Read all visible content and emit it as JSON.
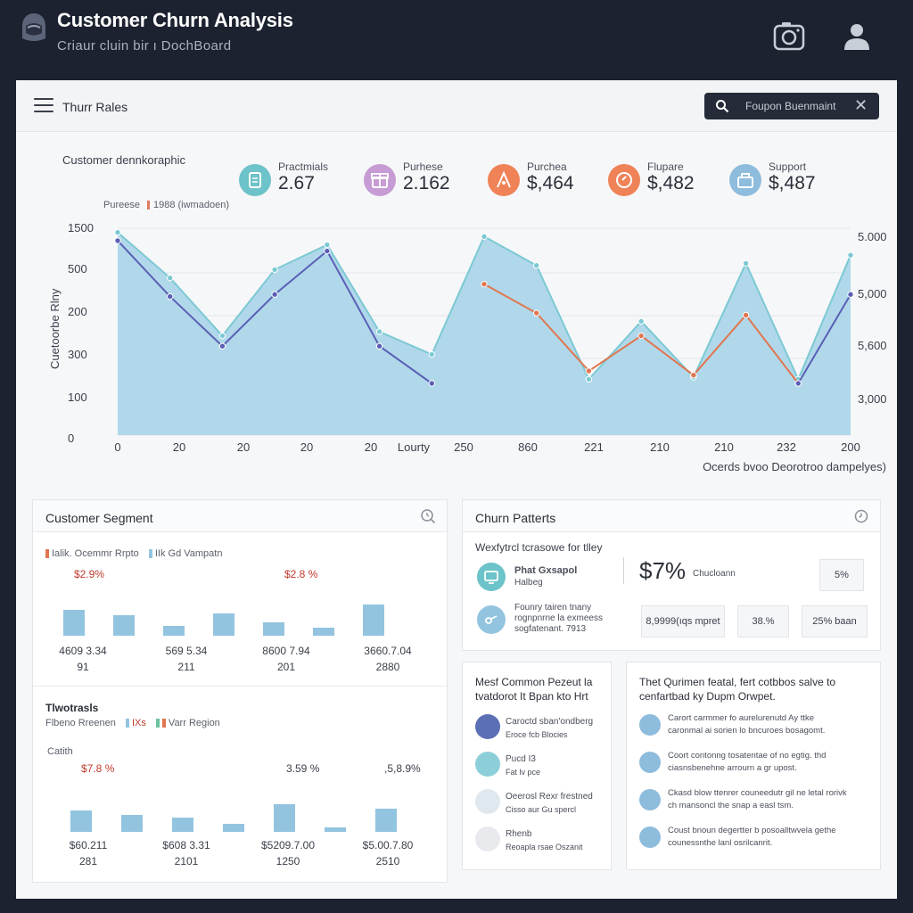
{
  "header": {
    "title": "Customer Churn Analysis",
    "subtitle": "Criaur cluin bir ı DochBoard",
    "icons": [
      "camera-icon",
      "user-icon"
    ]
  },
  "panel": {
    "title": "Thurr Rales",
    "search_text": "Foupon Buenmaint",
    "search_close": "✕"
  },
  "overview": {
    "demographics_label": "Customer dennkoraphic",
    "metrics": [
      {
        "label": "Practmials",
        "value": "2.67",
        "color": "#6cc3c9",
        "icon": "clipboard-icon"
      },
      {
        "label": "Purhese",
        "value": "2.162",
        "color": "#c79bd3",
        "icon": "gift-icon"
      },
      {
        "label": "Purchea",
        "value": "$,464",
        "color": "#ef8257",
        "icon": "person-icon"
      },
      {
        "label": "Flupare",
        "value": "$,482",
        "color": "#ef8257",
        "icon": "chat-icon"
      },
      {
        "label": "Support",
        "value": "$,487",
        "color": "#8dbcdc",
        "icon": "bag-icon"
      }
    ],
    "legend": {
      "left": "Pureese",
      "right": "1988 (iwmadoen)"
    }
  },
  "chart_data": {
    "type": "line",
    "title": "",
    "xlabel": "Lourty",
    "ylabel": "Cuetoorbe Rlny",
    "y_ticks_left": [
      "1500",
      "500",
      "200",
      "300",
      "100",
      "0"
    ],
    "y_ticks_right": [
      "5.000",
      "5,000",
      "5,600",
      "3,000"
    ],
    "x_ticks": [
      "0",
      "20",
      "20",
      "20",
      "20",
      "250",
      "860",
      "221",
      "210",
      "210",
      "232",
      "200"
    ],
    "footnote": "Ocerds bvoo Deorotroo dampelyes)",
    "series": [
      {
        "color": "#7cc9d3",
        "values": [
          98,
          76,
          48,
          80,
          92,
          50,
          39,
          96,
          82,
          27,
          55,
          28,
          83,
          27,
          87
        ]
      },
      {
        "color": "#5b5fb5",
        "values": [
          94,
          67,
          43,
          68,
          89,
          43,
          25
        ]
      },
      {
        "color": "#e0764f",
        "values": [
          73,
          59,
          31,
          48,
          29,
          58,
          25
        ]
      },
      {
        "color": "#5b5fb5",
        "values": [
          25,
          68
        ]
      }
    ],
    "area_color": "#a8d4e8"
  },
  "segment": {
    "title": "Customer Segment",
    "legend_a": "Ialik. Ocemmr Rrpto",
    "legend_b": "IIk Gd Vampatn",
    "pct_a": "$2.9%",
    "pct_b": "$2.8 %",
    "bars_top": [
      0.47,
      0.37,
      0.18,
      0.4,
      0.24,
      0.14,
      0.56
    ],
    "labels_top": [
      {
        "a": "4609 3.34",
        "b": "91"
      },
      {
        "a": "569 5.34",
        "b": "211"
      },
      {
        "a": "8600 7.94",
        "b": "201"
      },
      {
        "a": "3660.7.04",
        "b": "2880"
      }
    ],
    "sub_title": "Tlwotrasls",
    "sub_legend": "Flbeno Rreenen",
    "sub_legend_b": "IXs",
    "sub_legend_c": "Varr Region",
    "sub_label": "Catith",
    "pct_c": "$7.8 %",
    "pct_d": "3.59 %",
    "pct_e": ",5,8.9%",
    "bars_bottom": [
      0.42,
      0.32,
      0.27,
      0.16,
      0.53,
      0.09,
      0.44
    ],
    "labels_bottom": [
      {
        "a": "$60.211",
        "b": "281"
      },
      {
        "a": "$608 3.31",
        "b": "2101"
      },
      {
        "a": "$5209.7.00",
        "b": "1250"
      },
      {
        "a": "$5.00.7.80",
        "b": "2510"
      }
    ]
  },
  "patterns": {
    "title": "Churn Patterts",
    "subtitle": "Wexfytrcl tcrasowe for tlley",
    "item1_title": "Phat Gxsapol",
    "item1_sub": "Halbeg",
    "big_value": "$7%",
    "big_label": "Chucloann",
    "chip1": "5%",
    "item2_lines": [
      "Founry tairen tnany",
      "rognpnrne la exmeess",
      "sogfatenant. 7913"
    ],
    "chip2": "8,9999(ıqs mpret",
    "chip3": "38.%",
    "chip4": "25% baan"
  },
  "reasons": {
    "heading": "Mesf Common Pezeut la\ntvatdorot It Bpan kto Hrt",
    "items": [
      {
        "title": "Caroctd sban'ondberg",
        "sub": "Eroce fcb Blocies"
      },
      {
        "title": "Pucd I3",
        "sub": "Fat lv pce"
      },
      {
        "title": "Oeerosl Rexr frestned",
        "sub": "Cisso aur Gu spercl"
      },
      {
        "title": "Rhenb",
        "sub": "Reoapla rsae Oszanit"
      }
    ]
  },
  "insights": {
    "heading": "Thet Qurimen featal, fert cotbbos salve to\ncenfartbad ky Dupm Orwpet.",
    "items": [
      "Carort carmmer fo aurelurenutd Ay ttke\ncaronmal ai sorien lo bncuroes bosagomt.",
      "Coort contonng tosatentae of no egtig. thd\nciasnsbenehne arrourn a gr upost.",
      "Ckasd blow ttenrer couneedutr gil ne letal rorivk\nch mansoncl the snap a easl tsm.",
      "Coust bnoun degertter b posoalltwvela gethe\ncounessnthe lanl osrilcanrit."
    ]
  }
}
